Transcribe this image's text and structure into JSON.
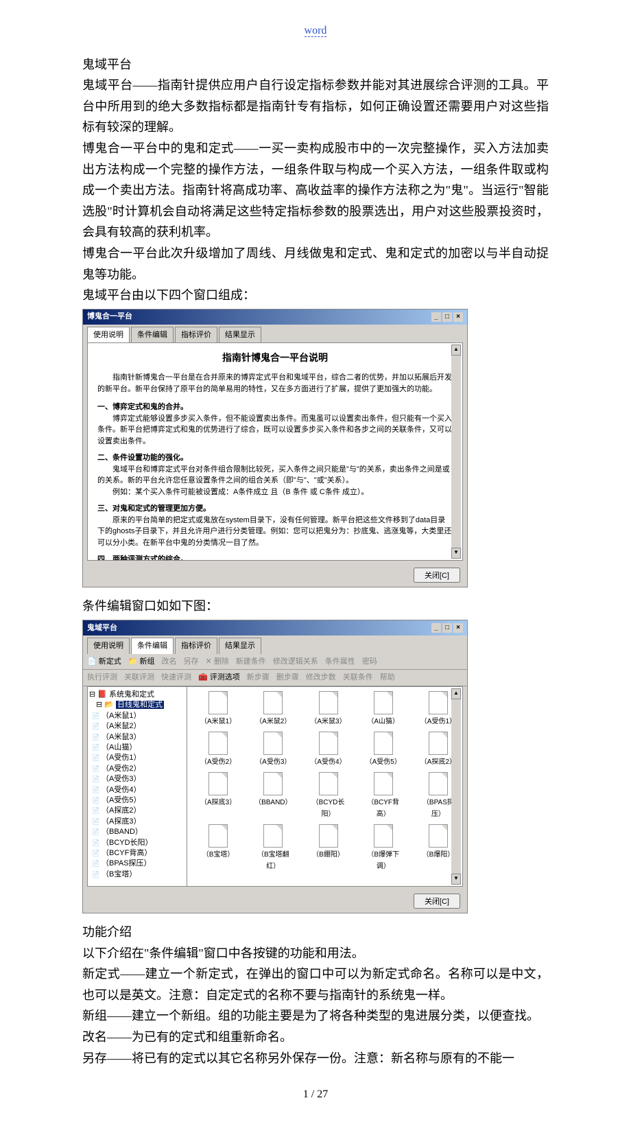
{
  "header_link": "word",
  "body": {
    "p1": "鬼域平台",
    "p2": "鬼域平台——指南针提供应用户自行设定指标参数并能对其进展综合评测的工具。平台中所用到的绝大多数指标都是指南针专有指标，如何正确设置还需要用户对这些指标有较深的理解。",
    "p3": "博鬼合一平台中的鬼和定式——一买一卖构成股市中的一次完整操作，买入方法加卖出方法构成一个完整的操作方法，一组条件取与构成一个买入方法，一组条件取或构成一个卖出方法。指南针将高成功率、高收益率的操作方法称之为\"鬼\"。当运行\"智能选股\"时计算机会自动将满足这些特定指标参数的股票选出，用户对这些股票投资时，会具有较高的获利机率。",
    "p4": "博鬼合一平台此次升级增加了周线、月线做鬼和定式、鬼和定式的加密以与半自动捉鬼等功能。",
    "p5": "鬼域平台由以下四个窗口组成：",
    "p6": "条件编辑窗口如如下图：",
    "p7": "功能介绍",
    "p8": "以下介绍在\"条件编辑\"窗口中各按键的功能和用法。",
    "p9": "新定式——建立一个新定式，在弹出的窗口中可以为新定式命名。名称可以是中文，也可以是英文。注意：自定定式的名称不要与指南针的系统鬼一样。",
    "p10": "新组——建立一个新组。组的功能主要是为了将各种类型的鬼进展分类，以便查找。",
    "p11": "改名——为已有的定式和组重新命名。",
    "p12": "另存——将已有的定式以其它名称另外保存一份。注意：新名称与原有的不能一"
  },
  "win1": {
    "title": "博鬼合一平台",
    "tabs": [
      "使用说明",
      "条件编辑",
      "指标评价",
      "结果显示"
    ],
    "heading": "指南针博鬼合一平台说明",
    "intro": "指南针新博鬼合一平台是在合并原来的博弈定式平台和鬼域平台，综合二者的优势，并加以拓展后开发的新平台。新平台保持了原平台的简单易用的特性，又在多方面进行了扩展，提供了更加强大的功能。",
    "s1t": "一、博弈定式和鬼的合并。",
    "s1b": "博弈定式能够设置多步买入条件，但不能设置卖出条件。而鬼虽可以设置卖出条件，但只能有一个买入条件。新平台把博弈定式和鬼的优势进行了综合，既可以设置多步买入条件和各步之间的关联条件，又可以设置卖出条件。",
    "s2t": "二、条件设置功能的强化。",
    "s2b1": "鬼域平台和博弈定式平台对条件组合限制比较死，买入条件之间只能是\"与\"的关系，卖出条件之间是或的关系。新的平台允许您任意设置条件之间的组合关系（即\"与\"、\"或\"关系）。",
    "s2b2": "例如：某个买入条件可能被设置成：A条件成立 且（B 条件 或 C条件 成立）。",
    "s3t": "三、对鬼和定式的管理更加方便。",
    "s3b": "原来的平台简单的把定式或鬼放在system目录下，没有任何管理。新平台把这些文件移到了data目录下的ghosts子目录下，并且允许用户进行分类管理。例如：您可以把鬼分为：抄底鬼、逃涨鬼等，大类里还可以分小类。在新平台中鬼的分类情况一目了然。",
    "s4t": "四、两种评测方式的综合。",
    "close": "关闭[C]"
  },
  "win2": {
    "title": "鬼域平台",
    "tabs": [
      "使用说明",
      "条件编辑",
      "指标评价",
      "结果显示"
    ],
    "tb1": [
      "新定式",
      "新组",
      "改名",
      "另存",
      "删除",
      "新建条件",
      "修改逻辑关系",
      "条件属性",
      "密码"
    ],
    "tb2": [
      "执行评测",
      "关联评测",
      "快速评测",
      "评测选项",
      "新步骤",
      "删步骤",
      "修改步数",
      "关联条件",
      "帮助"
    ],
    "tree_root": "系统鬼和定式",
    "tree_hl": "日线鬼和定式",
    "tree_items": [
      "（A米鼠1）",
      "（A米鼠2）",
      "（A米鼠3）",
      "（A山猫）",
      "（A受伤1）",
      "（A受伤2）",
      "（A受伤3）",
      "（A受伤4）",
      "（A受伤5）",
      "（A探底2）",
      "（A探底3）",
      "（BBAND）",
      "（BCYD长阳）",
      "（BCYF背高）",
      "（BPAS探压）",
      "（B宝塔）"
    ],
    "grid": [
      [
        "（A米鼠1）",
        "（A米鼠2）",
        "（A米鼠3）",
        "（A山猫）",
        "（A受伤1）"
      ],
      [
        "（A受伤2）",
        "（A受伤3）",
        "（A受伤4）",
        "（A受伤5）",
        "（A探底2）"
      ],
      [
        "（A探底3）",
        "（BBAND）",
        "（BCYD长阳）",
        "（BCYF背高）",
        "（BPAS探压）"
      ],
      [
        "（B宝塔）",
        "（B宝塔翻红）",
        "（B绷阳）",
        "（B爆弹下调）",
        "（B爆阳）"
      ]
    ],
    "close": "关闭[C]"
  },
  "pagenum": "1 / 27"
}
